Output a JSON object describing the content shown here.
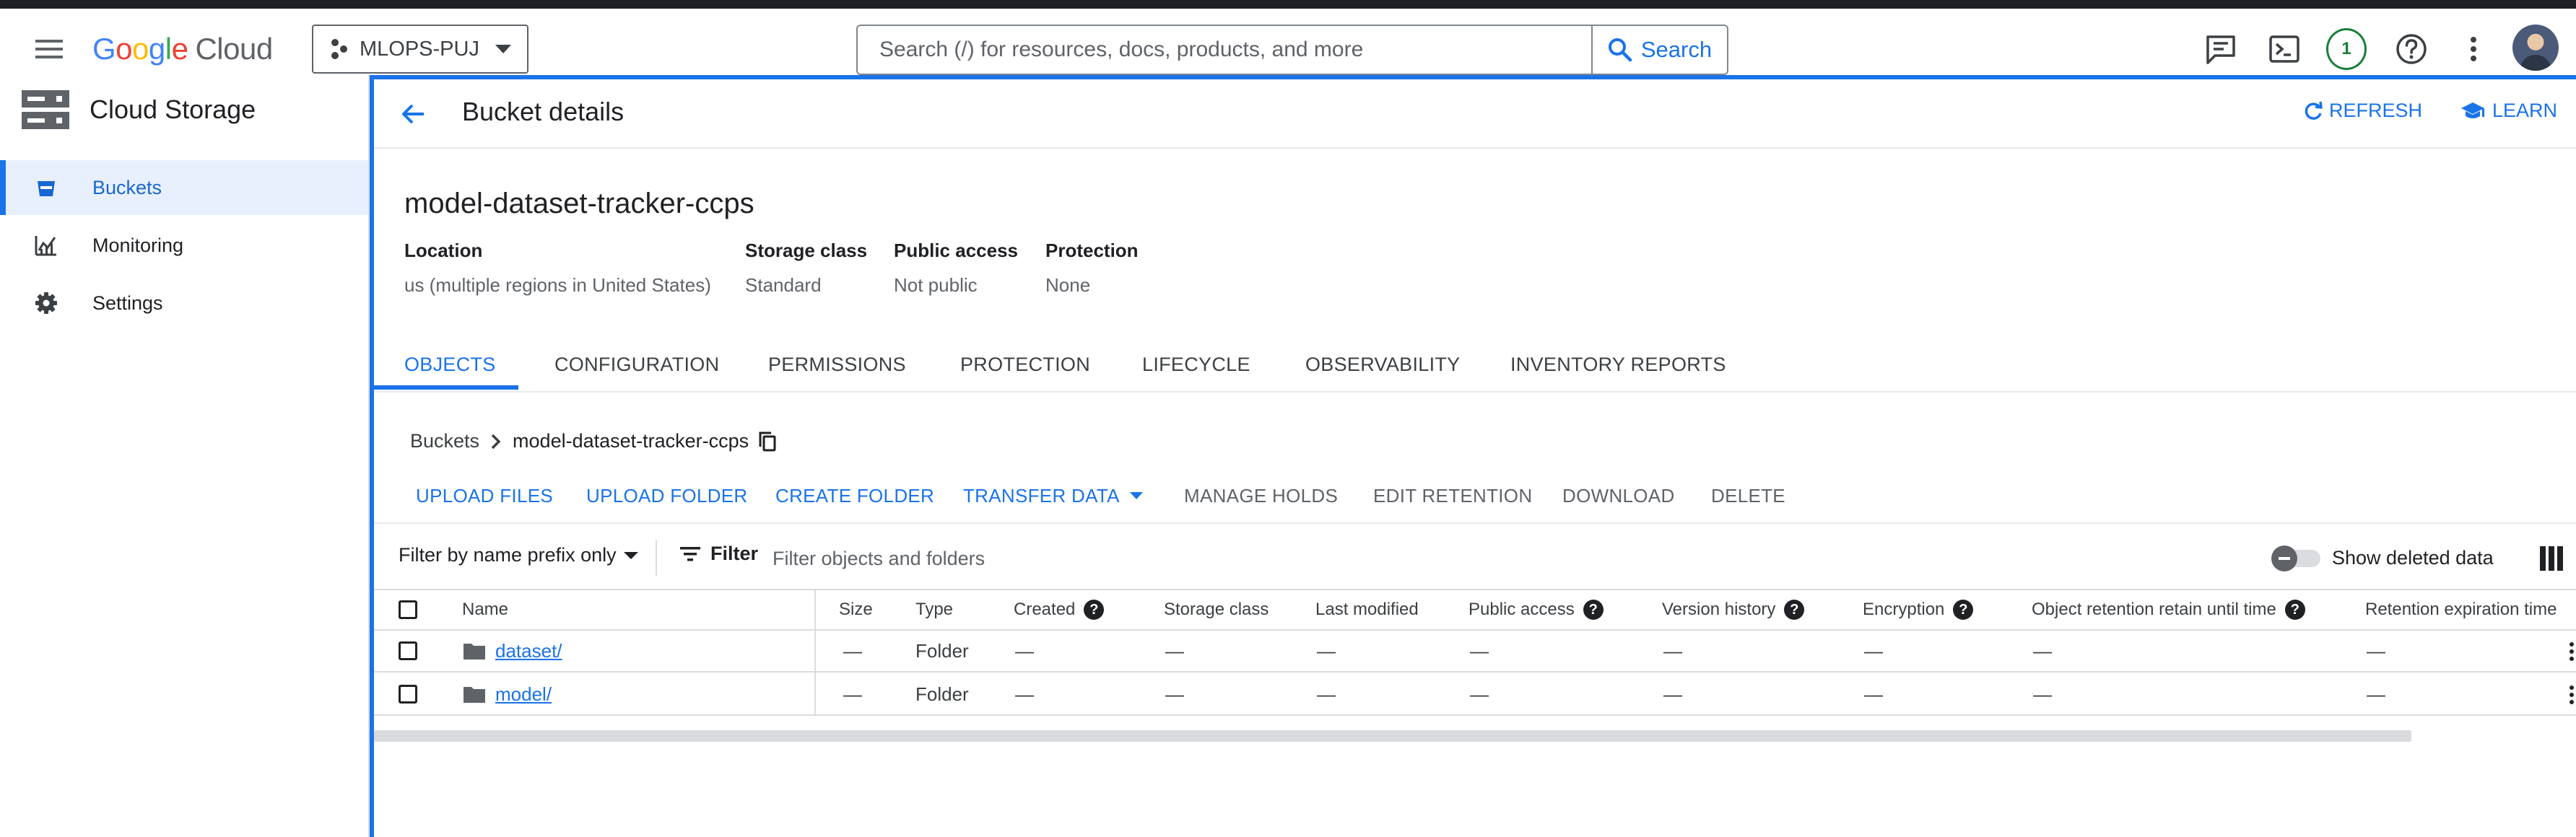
{
  "topbar": {
    "logo_google": "Google",
    "logo_cloud": "Cloud",
    "project": "MLOPS-PUJ",
    "search_placeholder": "Search (/) for resources, docs, products, and more",
    "search_button": "Search",
    "notification_count": "1",
    "icons": [
      "menu-icon",
      "feedback-icon",
      "cloud-shell-icon",
      "help-icon",
      "more-vert-icon"
    ]
  },
  "nav": {
    "title": "Cloud Storage",
    "items": [
      {
        "label": "Buckets",
        "icon": "bucket-icon",
        "active": true
      },
      {
        "label": "Monitoring",
        "icon": "monitoring-icon",
        "active": false
      },
      {
        "label": "Settings",
        "icon": "gear-icon",
        "active": false
      }
    ]
  },
  "header": {
    "title": "Bucket details",
    "refresh": "REFRESH",
    "learn": "LEARN"
  },
  "bucket": {
    "name": "model-dataset-tracker-ccps",
    "properties": [
      {
        "label": "Location",
        "value": "us (multiple regions in United States)"
      },
      {
        "label": "Storage class",
        "value": "Standard"
      },
      {
        "label": "Public access",
        "value": "Not public"
      },
      {
        "label": "Protection",
        "value": "None"
      }
    ]
  },
  "tabs": [
    "OBJECTS",
    "CONFIGURATION",
    "PERMISSIONS",
    "PROTECTION",
    "LIFECYCLE",
    "OBSERVABILITY",
    "INVENTORY REPORTS"
  ],
  "active_tab": "OBJECTS",
  "breadcrumb": {
    "root": "Buckets",
    "current": "model-dataset-tracker-ccps"
  },
  "actions": [
    {
      "label": "UPLOAD FILES",
      "enabled": true
    },
    {
      "label": "UPLOAD FOLDER",
      "enabled": true
    },
    {
      "label": "CREATE FOLDER",
      "enabled": true
    },
    {
      "label": "TRANSFER DATA",
      "enabled": true
    },
    {
      "label": "MANAGE HOLDS",
      "enabled": false
    },
    {
      "label": "EDIT RETENTION",
      "enabled": false
    },
    {
      "label": "DOWNLOAD",
      "enabled": false
    },
    {
      "label": "DELETE",
      "enabled": false
    }
  ],
  "filter": {
    "prefix_mode": "Filter by name prefix only",
    "button": "Filter",
    "placeholder": "Filter objects and folders",
    "show_deleted": "Show deleted data",
    "show_deleted_on": false
  },
  "table": {
    "columns": [
      "Name",
      "Size",
      "Type",
      "Created",
      "Storage class",
      "Last modified",
      "Public access",
      "Version history",
      "Encryption",
      "Object retention retain until time",
      "Retention expiration time"
    ],
    "rows": [
      {
        "name": "dataset/",
        "size": "—",
        "type": "Folder",
        "created": "—",
        "storage_class": "—",
        "last_modified": "—",
        "public_access": "—",
        "version_history": "—",
        "encryption": "—",
        "retain_until": "—",
        "retention_expiration": "—"
      },
      {
        "name": "model/",
        "size": "—",
        "type": "Folder",
        "created": "—",
        "storage_class": "—",
        "last_modified": "—",
        "public_access": "—",
        "version_history": "—",
        "encryption": "—",
        "retain_until": "—",
        "retention_expiration": "—"
      }
    ]
  },
  "colors": {
    "accent": "#1a73e8",
    "active_nav_bg": "#e8f0fe",
    "badge_green": "#188038",
    "text": "#202124",
    "muted": "#5f6368",
    "border": "#dadce0"
  }
}
